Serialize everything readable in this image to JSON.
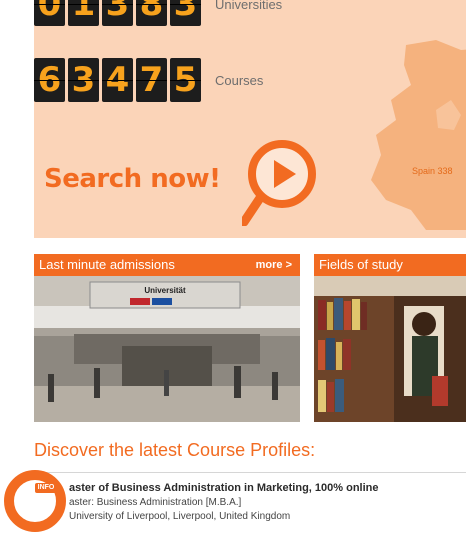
{
  "hero": {
    "counters": [
      {
        "digits": [
          "0",
          "1",
          "3",
          "8",
          "3"
        ],
        "label": "Universities"
      },
      {
        "digits": [
          "6",
          "3",
          "4",
          "7",
          "5"
        ],
        "label": "Courses"
      }
    ],
    "search_label": "Search now!",
    "map_label": "Spain 338"
  },
  "panels": {
    "left": {
      "title": "Last minute admissions",
      "more": "more >",
      "sign_text": "Universität"
    },
    "right": {
      "title": "Fields of study"
    }
  },
  "profiles": {
    "heading": "Discover the latest Course Profiles:",
    "items": [
      {
        "badge": "INFO",
        "title": "aster of Business Administration in Marketing, 100% online",
        "degree": "aster: Business Administration [M.B.A.]",
        "university": "University of Liverpool, Liverpool, United Kingdom"
      }
    ]
  },
  "colors": {
    "accent": "#f26b21",
    "hero_bg": "#fbd4b8",
    "digit_bg": "#1d1d1d",
    "digit_fg": "#f7a21d"
  }
}
